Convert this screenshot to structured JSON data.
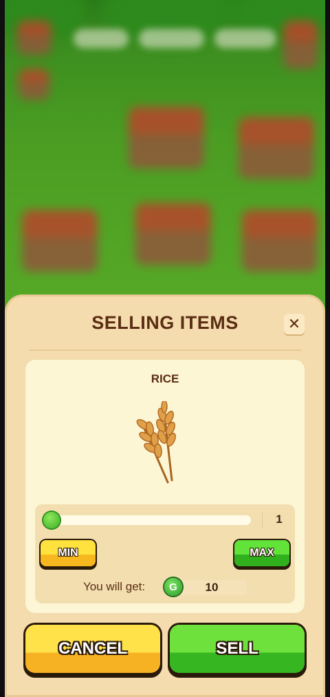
{
  "dialog": {
    "title": "SELLING ITEMS",
    "close_icon": "close-icon"
  },
  "item": {
    "name": "RICE",
    "icon": "rice-wheat-icon"
  },
  "quantity": {
    "value": "1",
    "slider_fraction": 0.0,
    "min_label": "MIN",
    "max_label": "MAX"
  },
  "reward": {
    "label": "You will get:",
    "currency_icon": "green-coin-icon",
    "currency_glyph": "G",
    "amount": "10"
  },
  "actions": {
    "cancel_label": "CANCEL",
    "sell_label": "SELL"
  },
  "colors": {
    "panel_bg": "#f4dcae",
    "title_text": "#5a2d14",
    "cancel_button": "#ffe14a",
    "sell_button": "#6ee13c"
  }
}
